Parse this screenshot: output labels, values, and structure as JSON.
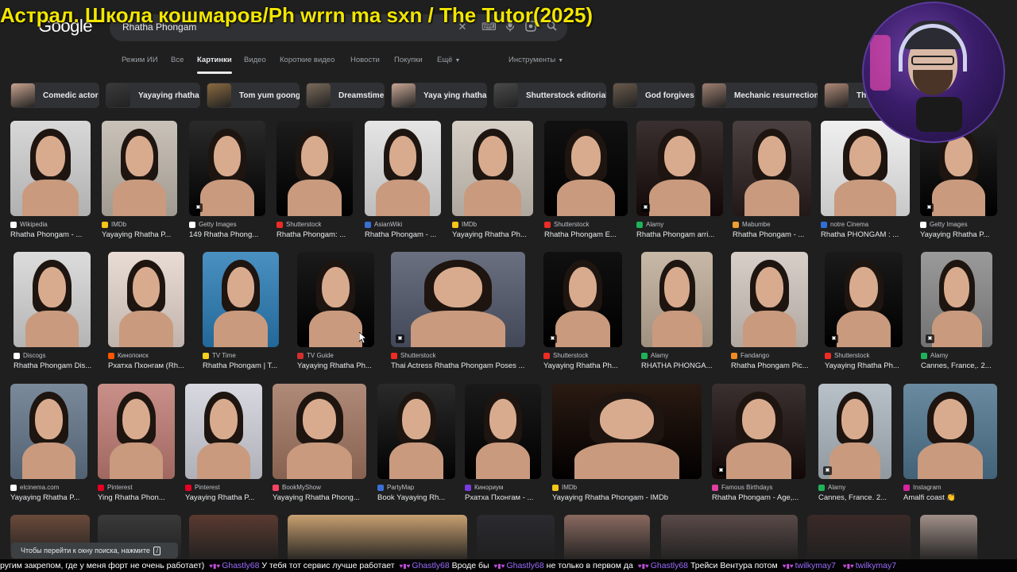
{
  "overlay": {
    "title": "Астрал. Школа кошмаров/Ph wrrn ma sxn / The Tutor(2025)"
  },
  "header": {
    "logo": "Google",
    "search_value": "Rhatha Phongam"
  },
  "tabs": [
    {
      "label": "Режим ИИ"
    },
    {
      "label": "Все"
    },
    {
      "label": "Картинки",
      "active": true
    },
    {
      "label": "Видео"
    },
    {
      "label": "Короткие видео"
    },
    {
      "label": "Новости"
    },
    {
      "label": "Покупки"
    },
    {
      "label": "Ещё"
    },
    {
      "label": "Инструменты"
    }
  ],
  "chips": [
    {
      "label": "Comedic actor",
      "color": "#c8a48e"
    },
    {
      "label": "Yayaying rhatha",
      "color": "#3a3a3a"
    },
    {
      "label": "Tom yum goong",
      "color": "#8a6a40"
    },
    {
      "label": "Dreamstime",
      "color": "#7a6a5a"
    },
    {
      "label": "Yaya ying rhatha",
      "color": "#caa896"
    },
    {
      "label": "Shutterstock editorial",
      "color": "#4a4a4a"
    },
    {
      "label": "God forgives",
      "color": "#6a5a4a"
    },
    {
      "label": "Mechanic resurrection",
      "color": "#a08070"
    },
    {
      "label": "Tha",
      "color": "#b08a78"
    }
  ],
  "results": {
    "row1": [
      {
        "source": "Wikipedia",
        "title": "Rhatha Phongam - ...",
        "fav": "#ffffff",
        "bg": "#d8d8d8"
      },
      {
        "source": "IMDb",
        "title": "Yayaying Rhatha P...",
        "fav": "#f5c518",
        "bg": "#c9c2b8"
      },
      {
        "source": "Getty Images",
        "title": "149 Rhatha Phong...",
        "fav": "#ffffff",
        "bg": "#2a2a2a"
      },
      {
        "source": "Shutterstock",
        "title": "Rhatha Phongam: ...",
        "fav": "#ee2b24",
        "bg": "#1c1c1c"
      },
      {
        "source": "AsianWiki",
        "title": "Rhatha Phongam - ...",
        "fav": "#3b6fd4",
        "bg": "#e5e5e5"
      },
      {
        "source": "IMDb",
        "title": "Yayaying Rhatha Ph...",
        "fav": "#f5c518",
        "bg": "#d6cfc6"
      },
      {
        "source": "Shutterstock",
        "title": "Rhatha Phongam E...",
        "fav": "#ee2b24",
        "bg": "#111111"
      },
      {
        "source": "Alamy",
        "title": "Rhatha Phongam arri...",
        "fav": "#1eb35a",
        "bg": "#3a3030"
      },
      {
        "source": "Mabumbe",
        "title": "Rhatha Phongam - ...",
        "fav": "#f0a030",
        "bg": "#4a4040"
      },
      {
        "source": "notre Cinema",
        "title": "Rhatha PHONGAM : ...",
        "fav": "#2f6fd6",
        "bg": "#f0f0f0"
      },
      {
        "source": "Getty Images",
        "title": "Yayaying Rhatha P...",
        "fav": "#ffffff",
        "bg": "#222222"
      }
    ],
    "row2": [
      {
        "source": "Discogs",
        "title": "Rhatha Phongam Dis...",
        "fav": "#ffffff",
        "bg": "#dcdcdc"
      },
      {
        "source": "Кинопоиск",
        "title": "Рхатха Пхонгам (Rh...",
        "fav": "#ff5500",
        "bg": "#e8dcd4"
      },
      {
        "source": "TV Time",
        "title": "Rhatha Phongam | T...",
        "fav": "#f5d020",
        "bg": "#4a90c0"
      },
      {
        "source": "TV Guide",
        "title": "Yayaying Rhatha Ph...",
        "fav": "#d32f2f",
        "bg": "#1a1a1a"
      },
      {
        "source": "Shutterstock",
        "title": "Thai Actress Rhatha Phongam Poses ...",
        "fav": "#ee2b24",
        "bg": "#6a7080"
      },
      {
        "source": "Shutterstock",
        "title": "Yayaying Rhatha Ph...",
        "fav": "#ee2b24",
        "bg": "#101010"
      },
      {
        "source": "Alamy",
        "title": "RHATHA PHONGA...",
        "fav": "#1eb35a",
        "bg": "#c8b8a8"
      },
      {
        "source": "Fandango",
        "title": "Rhatha Phongam Pic...",
        "fav": "#f08a24",
        "bg": "#d8cfc8"
      },
      {
        "source": "Shutterstock",
        "title": "Yayaying Rhatha Ph...",
        "fav": "#ee2b24",
        "bg": "#1a1a1a"
      },
      {
        "source": "Alamy",
        "title": "Cannes, France,. 2...",
        "fav": "#1eb35a",
        "bg": "#9a9a9a"
      }
    ],
    "row3": [
      {
        "source": "elcinema.com",
        "title": "Yayaying Rhatha P...",
        "fav": "#ffffff",
        "bg": "#7a8a9a"
      },
      {
        "source": "Pinterest",
        "title": "Ying Rhatha Phon...",
        "fav": "#e60023",
        "bg": "#c89088"
      },
      {
        "source": "Pinterest",
        "title": "Yayaying Rhatha P...",
        "fav": "#e60023",
        "bg": "#d8d8e0"
      },
      {
        "source": "BookMyShow",
        "title": "Yayaying Rhatha Phong...",
        "fav": "#f84464",
        "bg": "#b08a78"
      },
      {
        "source": "PartyMap",
        "title": "Book Yayaying Rh...",
        "fav": "#3b6fd4",
        "bg": "#2a2a2a"
      },
      {
        "source": "Кинориум",
        "title": "Рхатха Пхонгам - ...",
        "fav": "#7a3ae0",
        "bg": "#1a1a1a"
      },
      {
        "source": "IMDb",
        "title": "Yayaying Rhatha Phongam - IMDb",
        "fav": "#f5c518",
        "bg": "#2a1a12"
      },
      {
        "source": "Famous Birthdays",
        "title": "Rhatha Phongam - Age,...",
        "fav": "#e040a0",
        "bg": "#3a3030"
      },
      {
        "source": "Alamy",
        "title": "Cannes, France. 2...",
        "fav": "#1eb35a",
        "bg": "#b8c0c8"
      },
      {
        "source": "Instagram",
        "title": "Amalfi coast 👏",
        "fav": "#d6249f",
        "bg": "#6a8aa0"
      }
    ],
    "row4_colors": [
      "#6a4a3a",
      "#3a3a3a",
      "#5a3a30",
      "#c8a070",
      "#2a2a30",
      "#8a6a60",
      "#5a4a48",
      "#3a2a28",
      "#a09088"
    ]
  },
  "tooltip": {
    "text": "Чтобы перейти к окну поиска, нажмите",
    "key": "/"
  },
  "chat": [
    {
      "user": "",
      "text": "ругим закрепом, где у меня форт не очень работает)"
    },
    {
      "user": "Ghastly68",
      "text": "У тебя тот сервис лучше работает"
    },
    {
      "user": "Ghastly68",
      "text": "Вроде бы"
    },
    {
      "user": "Ghastly68",
      "text": "не только в первом да"
    },
    {
      "user": "Ghastly68",
      "text": "Трейси Вентура потом"
    },
    {
      "user": "twilkymay7",
      "text": ""
    },
    {
      "user": "twilkymay7",
      "text": ""
    }
  ]
}
